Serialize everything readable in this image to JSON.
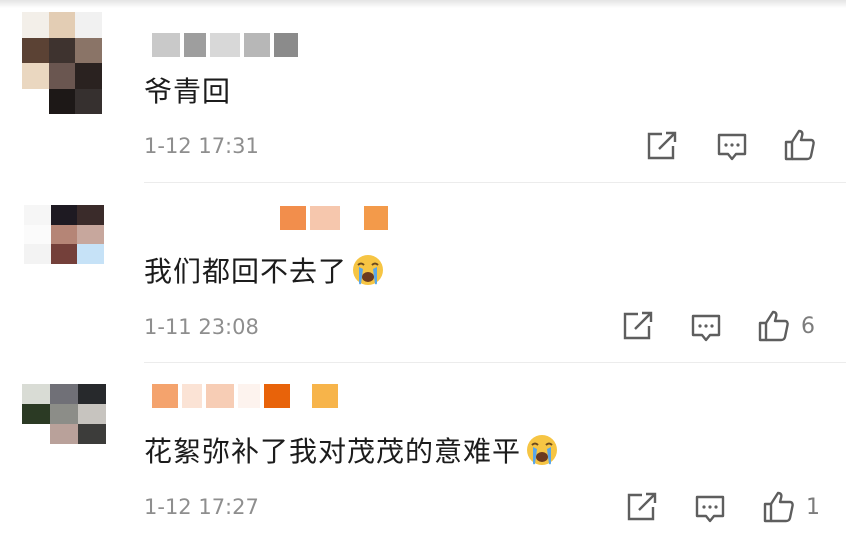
{
  "comments": [
    {
      "text": "爷青回",
      "time": "1-12 17:31",
      "emoji": "",
      "likes": ""
    },
    {
      "text": "我们都回不去了",
      "time": "1-11 23:08",
      "emoji": "crying-face-icon",
      "likes": "6"
    },
    {
      "text": "花絮弥补了我对茂茂的意难平",
      "time": "1-12 17:27",
      "emoji": "crying-face-icon",
      "likes": "1"
    }
  ],
  "actions": {
    "share_icon": "share-icon",
    "reply_icon": "comment-icon",
    "like_icon": "like-icon"
  },
  "colors": {
    "text": "#1c1c1c",
    "timestamp": "#8e8e8e",
    "icon": "#5e5e5e",
    "emoji_face": "#f6c544",
    "emoji_tear": "#59a6e8"
  }
}
